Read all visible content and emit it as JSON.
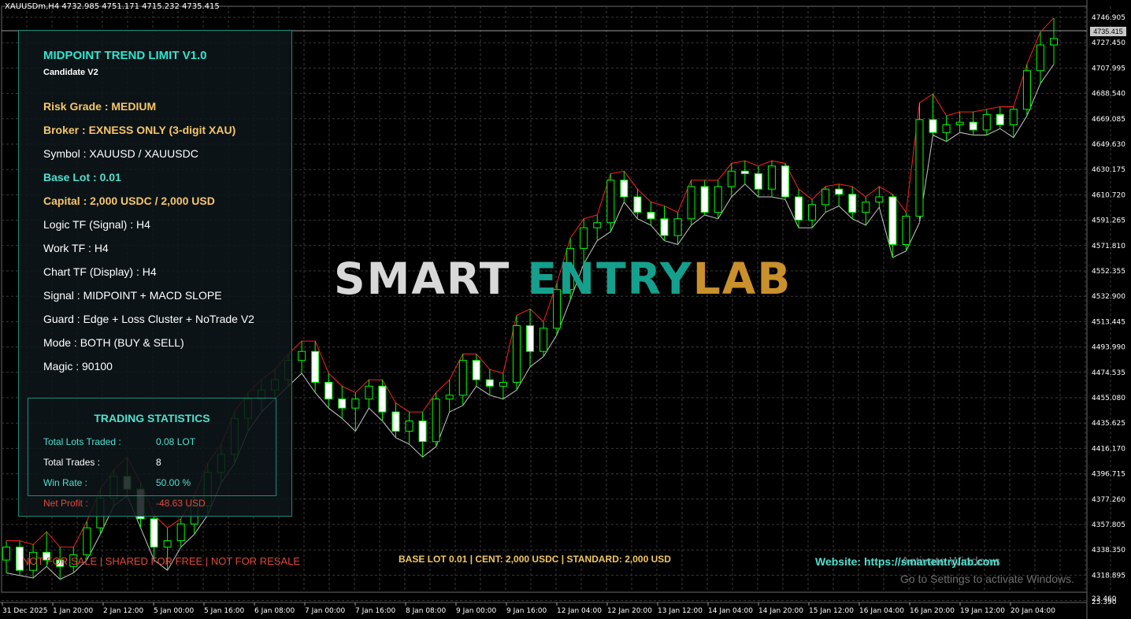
{
  "symbol_header": "XAUUSDm,H4  4732.985 4751.171 4715.232 4735.415",
  "current_price_tag": "4735.415",
  "price_axis": [
    "4746.905",
    "4727.450",
    "4707.995",
    "4688.540",
    "4669.085",
    "4649.630",
    "4630.175",
    "4610.720",
    "4591.265",
    "4571.810",
    "4552.355",
    "4532.900",
    "4513.445",
    "4493.990",
    "4474.535",
    "4455.080",
    "4435.625",
    "4416.170",
    "4396.715",
    "4377.260",
    "4357.805",
    "4338.350",
    "4318.895",
    "23.460",
    "25.390"
  ],
  "time_axis": [
    "31 Dec 2025",
    "1 Jan 20:00",
    "2 Jan 12:00",
    "5 Jan 00:00",
    "5 Jan 16:00",
    "6 Jan 08:00",
    "7 Jan 00:00",
    "7 Jan 16:00",
    "8 Jan 08:00",
    "9 Jan 00:00",
    "9 Jan 16:00",
    "12 Jan 04:00",
    "12 Jan 20:00",
    "13 Jan 12:00",
    "14 Jan 04:00",
    "14 Jan 20:00",
    "15 Jan 12:00",
    "16 Jan 04:00",
    "16 Jan 20:00",
    "19 Jan 12:00",
    "20 Jan 04:00"
  ],
  "colors": {
    "bull_candle": "#000000",
    "bear_candle": "#ffffff",
    "candle_outline": "#00ff00",
    "grid": "#3a3a3a",
    "upper_band": "#ff2020",
    "lower_band": "#c8c8c8",
    "accent_teal": "#2fe6d0",
    "accent_gold": "#f6c66a",
    "loss_red": "#e0483c"
  },
  "panel": {
    "title": "MIDPOINT TREND LIMIT V1.0",
    "subtitle": "Candidate V2",
    "rows": [
      {
        "text": "Risk Grade : MEDIUM",
        "style": "gold"
      },
      {
        "text": "Broker : EXNESS ONLY (3-digit XAU)",
        "style": "gold"
      },
      {
        "text": "Symbol : XAUUSD / XAUUSDC",
        "style": "plain"
      },
      {
        "text": "Base Lot : 0.01",
        "style": "teal"
      },
      {
        "text": "Capital : 2,000 USDC / 2,000 USD",
        "style": "gold"
      },
      {
        "text": "Logic TF (Signal) : H4",
        "style": "plain"
      },
      {
        "text": "Work TF : H4",
        "style": "plain"
      },
      {
        "text": "Chart TF (Display) : H4",
        "style": "plain"
      },
      {
        "text": "Signal : MIDPOINT + MACD SLOPE",
        "style": "plain"
      },
      {
        "text": "Guard : Edge + Loss Cluster + NoTrade V2",
        "style": "plain"
      },
      {
        "text": "Mode : BOTH (BUY & SELL)",
        "style": "plain"
      },
      {
        "text": "Magic : 90100",
        "style": "plain"
      }
    ]
  },
  "stats": {
    "title": "TRADING STATISTICS",
    "items": [
      {
        "label": "Total Lots Traded :",
        "value": "0.08 LOT",
        "color": "#4fe0d0"
      },
      {
        "label": "Total Trades :",
        "value": "8",
        "color": "#ffffff"
      },
      {
        "label": "Win Rate :",
        "value": "50.00 %",
        "color": "#4fe0d0"
      },
      {
        "label": "Net Profit :",
        "value": "-48.63 USD",
        "color": "#e0483c"
      }
    ]
  },
  "watermark": {
    "part1": "SMART ",
    "part2": "ENTRY",
    "part3": "LAB"
  },
  "footer": {
    "left": "NOT FOR SALE  |  SHARED FOR FREE  |  NOT FOR RESALE",
    "middle": "BASE LOT 0.01 | CENT: 2,000 USDC | STANDARD: 2,000 USD",
    "right": "Website: https://smartentrylab.com"
  },
  "os_notice": {
    "line1": "Activate Windows",
    "line2": "Go to Settings to activate Windows."
  },
  "chart_data": {
    "type": "candlestick",
    "ylim": [
      4305,
      4760
    ],
    "ohlc": [
      [
        4330,
        4345,
        4320,
        4340
      ],
      [
        4340,
        4345,
        4318,
        4322
      ],
      [
        4322,
        4342,
        4316,
        4336
      ],
      [
        4336,
        4352,
        4325,
        4330
      ],
      [
        4330,
        4340,
        4315,
        4325
      ],
      [
        4325,
        4340,
        4320,
        4334
      ],
      [
        4334,
        4360,
        4330,
        4355
      ],
      [
        4355,
        4385,
        4350,
        4378
      ],
      [
        4378,
        4400,
        4372,
        4395
      ],
      [
        4395,
        4410,
        4380,
        4385
      ],
      [
        4385,
        4390,
        4355,
        4362
      ],
      [
        4362,
        4365,
        4330,
        4340
      ],
      [
        4340,
        4355,
        4322,
        4345
      ],
      [
        4345,
        4362,
        4340,
        4358
      ],
      [
        4358,
        4380,
        4350,
        4372
      ],
      [
        4372,
        4405,
        4365,
        4398
      ],
      [
        4398,
        4420,
        4390,
        4412
      ],
      [
        4412,
        4445,
        4405,
        4440
      ],
      [
        4440,
        4460,
        4430,
        4455
      ],
      [
        4455,
        4470,
        4445,
        4462
      ],
      [
        4462,
        4478,
        4455,
        4470
      ],
      [
        4470,
        4490,
        4465,
        4485
      ],
      [
        4485,
        4500,
        4475,
        4492
      ],
      [
        4492,
        4500,
        4460,
        4468
      ],
      [
        4468,
        4475,
        4448,
        4455
      ],
      [
        4455,
        4465,
        4440,
        4448
      ],
      [
        4448,
        4460,
        4430,
        4455
      ],
      [
        4455,
        4470,
        4448,
        4465
      ],
      [
        4465,
        4470,
        4438,
        4445
      ],
      [
        4445,
        4452,
        4425,
        4430
      ],
      [
        4430,
        4445,
        4420,
        4438
      ],
      [
        4438,
        4445,
        4410,
        4422
      ],
      [
        4422,
        4460,
        4418,
        4455
      ],
      [
        4455,
        4470,
        4445,
        4458
      ],
      [
        4458,
        4490,
        4450,
        4485
      ],
      [
        4485,
        4490,
        4465,
        4470
      ],
      [
        4470,
        4478,
        4458,
        4465
      ],
      [
        4465,
        4475,
        4455,
        4468
      ],
      [
        4468,
        4520,
        4462,
        4512
      ],
      [
        4512,
        4525,
        4480,
        4492
      ],
      [
        4492,
        4515,
        4488,
        4510
      ],
      [
        4510,
        4545,
        4505,
        4540
      ],
      [
        4540,
        4580,
        4532,
        4572
      ],
      [
        4572,
        4595,
        4560,
        4588
      ],
      [
        4588,
        4598,
        4578,
        4592
      ],
      [
        4592,
        4630,
        4585,
        4625
      ],
      [
        4625,
        4632,
        4608,
        4612
      ],
      [
        4612,
        4618,
        4595,
        4600
      ],
      [
        4600,
        4608,
        4590,
        4595
      ],
      [
        4595,
        4605,
        4578,
        4582
      ],
      [
        4582,
        4600,
        4575,
        4595
      ],
      [
        4595,
        4625,
        4590,
        4620
      ],
      [
        4620,
        4625,
        4598,
        4600
      ],
      [
        4600,
        4625,
        4595,
        4620
      ],
      [
        4620,
        4638,
        4612,
        4632
      ],
      [
        4632,
        4640,
        4622,
        4630
      ],
      [
        4630,
        4636,
        4612,
        4618
      ],
      [
        4618,
        4640,
        4612,
        4636
      ],
      [
        4636,
        4638,
        4610,
        4612
      ],
      [
        4612,
        4618,
        4588,
        4594
      ],
      [
        4594,
        4610,
        4588,
        4606
      ],
      [
        4606,
        4620,
        4600,
        4618
      ],
      [
        4618,
        4622,
        4605,
        4614
      ],
      [
        4614,
        4620,
        4595,
        4600
      ],
      [
        4600,
        4612,
        4590,
        4608
      ],
      [
        4608,
        4620,
        4604,
        4612
      ],
      [
        4612,
        4614,
        4565,
        4575
      ],
      [
        4575,
        4600,
        4570,
        4597
      ],
      [
        4597,
        4685,
        4592,
        4672
      ],
      [
        4672,
        4692,
        4660,
        4662
      ],
      [
        4662,
        4675,
        4655,
        4668
      ],
      [
        4668,
        4678,
        4662,
        4670
      ],
      [
        4670,
        4678,
        4660,
        4664
      ],
      [
        4664,
        4680,
        4660,
        4676
      ],
      [
        4676,
        4682,
        4665,
        4668
      ],
      [
        4668,
        4682,
        4658,
        4680
      ],
      [
        4680,
        4715,
        4675,
        4710
      ],
      [
        4710,
        4740,
        4700,
        4730
      ],
      [
        4730,
        4751,
        4715,
        4735
      ]
    ]
  }
}
